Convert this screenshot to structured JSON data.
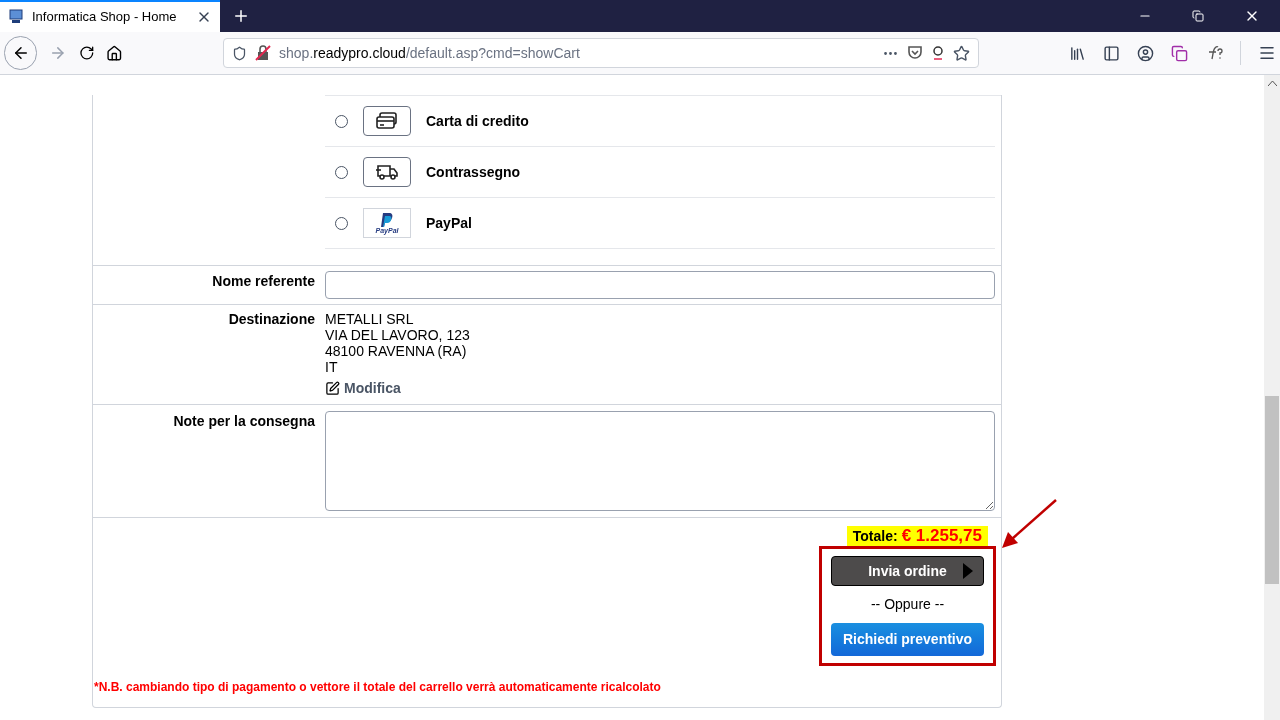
{
  "browser": {
    "tab_title": "Informatica Shop - Home",
    "url_host": "shop.",
    "url_domain": "readypro.cloud",
    "url_path": "/default.asp?cmd=showCart"
  },
  "payment_options": [
    {
      "kind": "card",
      "label": "Carta di credito",
      "selected": false
    },
    {
      "kind": "truck",
      "label": "Contrassegno",
      "selected": false
    },
    {
      "kind": "paypal",
      "label": "PayPal",
      "logo_text": "PayPal",
      "selected": false
    }
  ],
  "contact": {
    "label": "Nome referente"
  },
  "destination": {
    "label": "Destinazione",
    "lines": [
      "METALLI SRL",
      "VIA DEL LAVORO, 123",
      "48100 RAVENNA (RA)",
      "IT"
    ],
    "edit_link": "Modifica"
  },
  "notes": {
    "label": "Note per la consegna"
  },
  "total": {
    "label": "Totale:",
    "amount": "€ 1.255,75"
  },
  "actions": {
    "submit": "Invia ordine",
    "separator": "-- Oppure --",
    "quote": "Richiedi preventivo"
  },
  "footnote": "*N.B. cambiando tipo di pagamento o vettore il totale del carrello verrà automaticamente ricalcolato"
}
